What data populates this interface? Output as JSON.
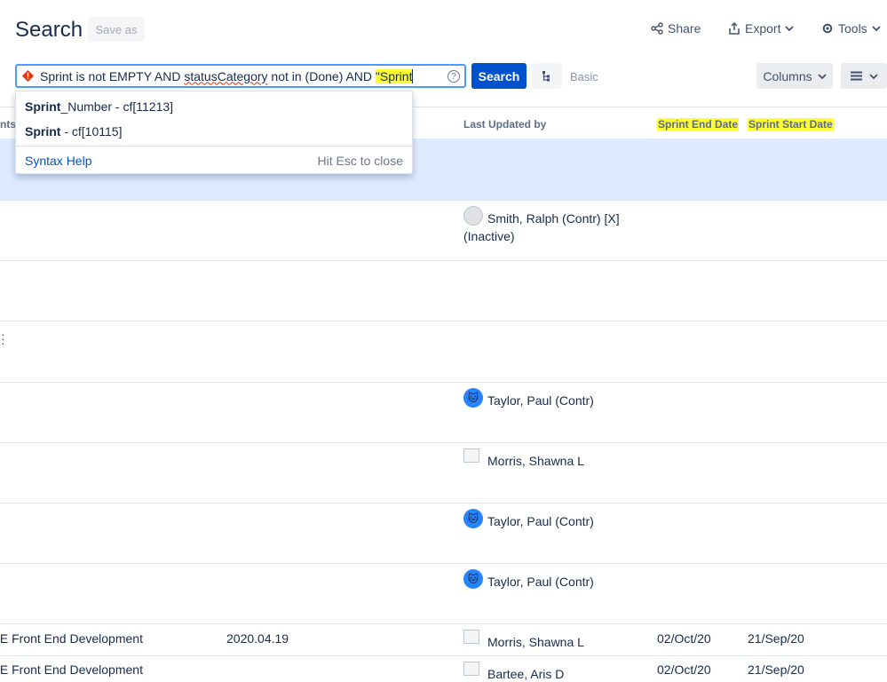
{
  "header": {
    "title": "Search",
    "save_as": "Save as",
    "share": "Share",
    "export": "Export",
    "tools": "Tools"
  },
  "query": {
    "text_before": "Sprint is not EMPTY AND ",
    "text_squiggle": "statusCategory",
    "text_after": " not in (Done) AND ",
    "text_highlight": "\"Sprint",
    "help_glyph": "?"
  },
  "toolbar": {
    "search_label": "Search",
    "basic_label": "Basic",
    "columns_label": "Columns"
  },
  "autocomplete": {
    "items": [
      {
        "bold": "Sprint",
        "rest": "_Number - cf[11213]"
      },
      {
        "bold": "Sprint",
        "rest": " - cf[10115]"
      }
    ],
    "syntax_help": "Syntax Help",
    "hint": "Hit Esc to close"
  },
  "columns": {
    "partial": "nts",
    "last_updated_by": "Last Updated by",
    "sprint_end": "Sprint End Date",
    "sprint_start": "Sprint Start Date"
  },
  "rows": [
    {
      "user": "Smith, Ralph (Contr) [X]",
      "user2": "(Inactive)"
    },
    {
      "user": "Taylor, Paul (Contr)"
    },
    {
      "user": "Morris, Shawna L"
    },
    {
      "user": "Taylor, Paul (Contr)"
    },
    {
      "user": "Taylor, Paul (Contr)"
    },
    {
      "component": "/E Front End Development",
      "version": "2020.04.19",
      "user": "Morris, Shawna L",
      "end": "02/Oct/20",
      "start": "21/Sep/20"
    },
    {
      "component": "/E Front End Development",
      "user": "Bartee, Aris D",
      "end": "02/Oct/20",
      "start": "21/Sep/20"
    }
  ],
  "colors": {
    "accent": "#0052cc",
    "highlight": "#fdfd32",
    "selected_row": "#deebff",
    "error": "#de350b"
  },
  "icons": [
    "share-icon",
    "export-icon",
    "gear-icon",
    "chevron-down-icon",
    "error-icon",
    "help-icon",
    "tree-icon",
    "menu-icon",
    "avatar"
  ]
}
